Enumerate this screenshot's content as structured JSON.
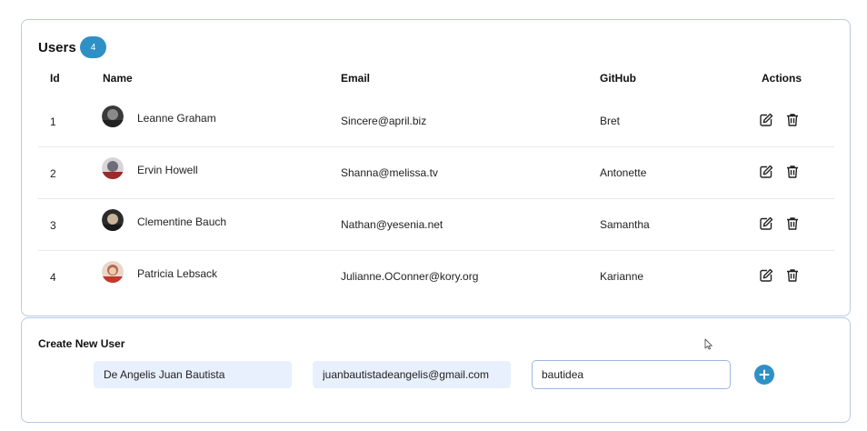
{
  "users_panel": {
    "title": "Users",
    "count": "4",
    "columns": {
      "id": "Id",
      "name": "Name",
      "email": "Email",
      "github": "GitHub",
      "actions": "Actions"
    },
    "rows": [
      {
        "id": "1",
        "name": "Leanne Graham",
        "email": "Sincere@april.biz",
        "github": "Bret"
      },
      {
        "id": "2",
        "name": "Ervin Howell",
        "email": "Shanna@melissa.tv",
        "github": "Antonette"
      },
      {
        "id": "3",
        "name": "Clementine Bauch",
        "email": "Nathan@yesenia.net",
        "github": "Samantha"
      },
      {
        "id": "4",
        "name": "Patricia Lebsack",
        "email": "Julianne.OConner@kory.org",
        "github": "Karianne"
      }
    ]
  },
  "create_panel": {
    "title": "Create New User",
    "name_value": "De Angelis Juan Bautista",
    "email_value": "juanbautistadeangelis@gmail.com",
    "github_value": "bautidea"
  },
  "icons": {
    "edit": "edit-icon",
    "delete": "trash-icon",
    "add": "plus-circle-icon"
  },
  "colors": {
    "accent": "#2f90c6",
    "border": "#b8c9e6",
    "input_fill": "#e8f0fd"
  }
}
